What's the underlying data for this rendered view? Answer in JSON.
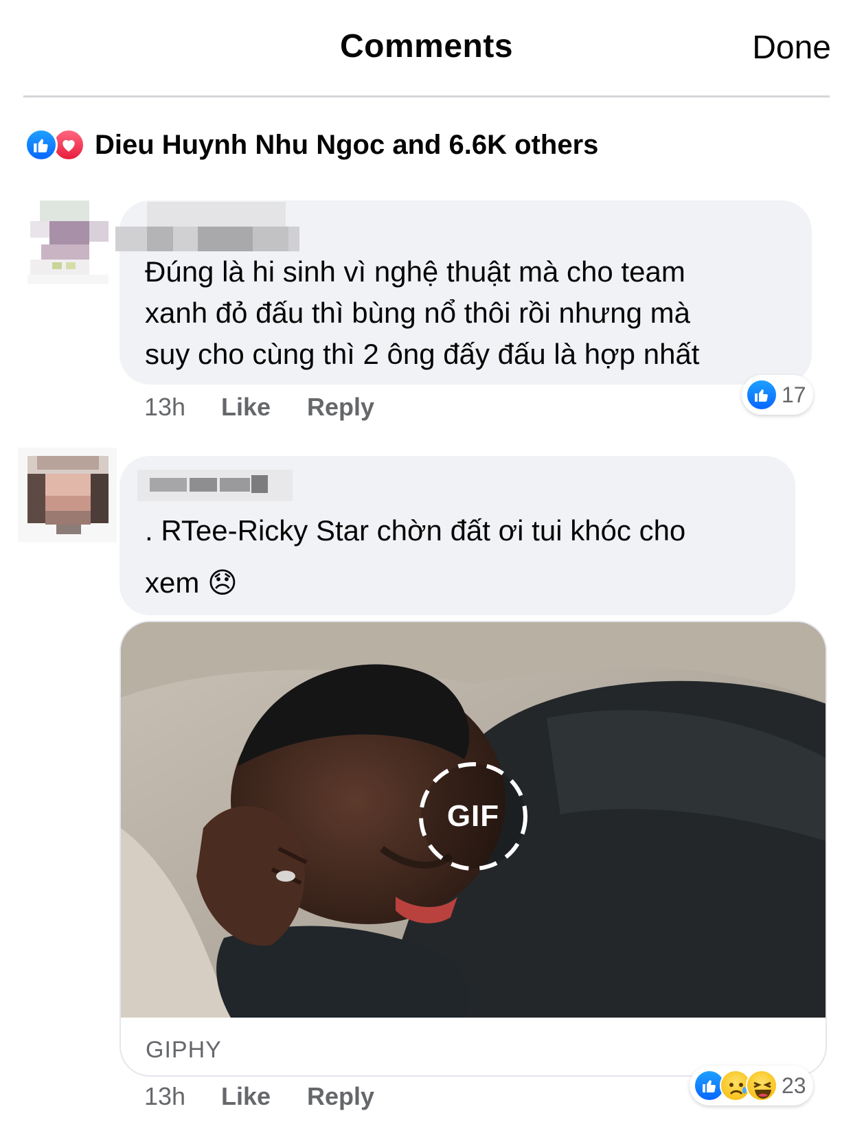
{
  "header": {
    "title": "Comments",
    "done_label": "Done"
  },
  "reactions_summary": {
    "text": "Dieu Huynh Nhu Ngoc and 6.6K others",
    "icons": [
      "like-icon",
      "love-icon"
    ]
  },
  "comments": [
    {
      "text_lines": [
        "Đúng là hi sinh vì nghệ thuật  mà cho team",
        "xanh đỏ đấu thì bùng nổ thôi rồi nhưng mà",
        "suy cho cùng thì 2 ông đấy đấu là hợp nhất"
      ],
      "time": "13h",
      "like_label": "Like",
      "reply_label": "Reply",
      "reaction_count": "17",
      "reaction_icons": [
        "like-icon"
      ]
    },
    {
      "text_lines": [
        ". RTee-Ricky Star chờn đất ơi tui khóc cho",
        "xem 😞"
      ],
      "gif_label": "GIF",
      "gif_source": "GIPHY",
      "time": "13h",
      "like_label": "Like",
      "reply_label": "Reply",
      "reaction_count": "23",
      "reaction_icons": [
        "like-icon",
        "sad-icon",
        "haha-icon"
      ]
    }
  ],
  "colors": {
    "accent": "#0866ff",
    "bubble": "#f0f2f5",
    "meta": "#65676b",
    "love": "#e61e3c"
  }
}
